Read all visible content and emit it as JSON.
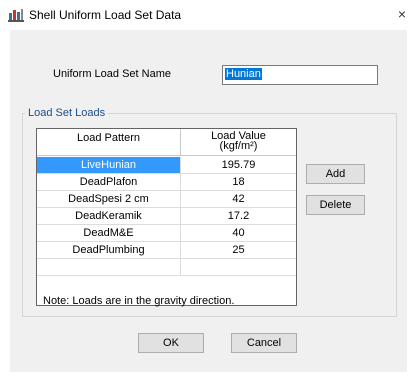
{
  "window": {
    "title": "Shell Uniform Load Set Data",
    "close_glyph": "×"
  },
  "name_field": {
    "label": "Uniform Load Set Name",
    "value": "Hunian"
  },
  "group": {
    "title": "Load Set Loads",
    "columns": {
      "pattern": "Load Pattern",
      "value_line1": "Load Value",
      "value_line2": "(kgf/m²)"
    },
    "rows": [
      {
        "pattern": "LiveHunian",
        "value": "195.79"
      },
      {
        "pattern": "DeadPlafon",
        "value": "18"
      },
      {
        "pattern": "DeadSpesi 2 cm",
        "value": "42"
      },
      {
        "pattern": "DeadKeramik",
        "value": "17.2"
      },
      {
        "pattern": "DeadM&E",
        "value": "40"
      },
      {
        "pattern": "DeadPlumbing",
        "value": "25"
      }
    ],
    "note": "Note:  Loads are in the gravity direction.",
    "add_label": "Add",
    "delete_label": "Delete"
  },
  "footer": {
    "ok_label": "OK",
    "cancel_label": "Cancel"
  },
  "colors": {
    "selection": "#3399ff",
    "input_highlight": "#0078d7",
    "legend_text": "#1a4e8a"
  }
}
